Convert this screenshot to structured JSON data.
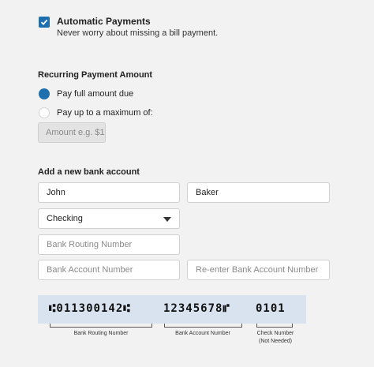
{
  "auto_payments": {
    "checked": true,
    "title": "Automatic Payments",
    "subtitle": "Never worry about missing a bill payment."
  },
  "recurring": {
    "title": "Recurring Payment Amount",
    "option_full": "Pay full amount due",
    "option_max": "Pay up to a maximum of:",
    "selected": "full",
    "amount_placeholder": "Amount e.g. $1"
  },
  "bank": {
    "title": "Add a new bank account",
    "first_name": "John",
    "last_name": "Baker",
    "account_type": "Checking",
    "routing_placeholder": "Bank Routing Number",
    "account_placeholder": "Bank Account Number",
    "reenter_placeholder": "Re-enter Bank Account Number"
  },
  "check_image": {
    "routing_digits": "⑆011300142⑆",
    "account_digits": "12345678⑈",
    "check_digits": "0101",
    "routing_caption": "Bank Routing Number",
    "account_caption": "Bank Account Number",
    "check_caption_line1": "Check Number",
    "check_caption_line2": "(Not Needed)"
  },
  "colors": {
    "accent": "#1d6fb0",
    "check_bg": "#d9e3f0"
  }
}
